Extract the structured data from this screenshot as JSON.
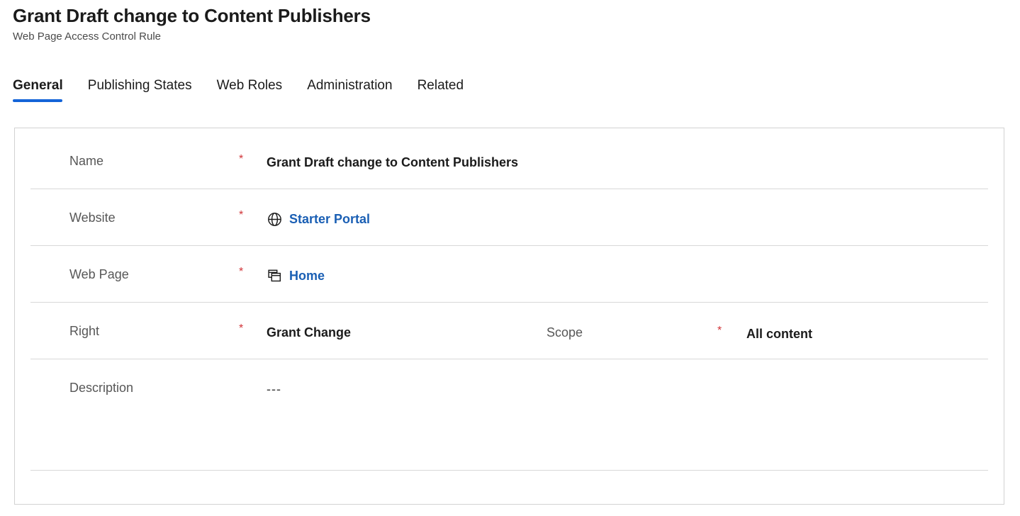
{
  "header": {
    "title": "Grant Draft change to Content Publishers",
    "subtitle": "Web Page Access Control Rule"
  },
  "tabs": [
    {
      "label": "General",
      "active": true
    },
    {
      "label": "Publishing States",
      "active": false
    },
    {
      "label": "Web Roles",
      "active": false
    },
    {
      "label": "Administration",
      "active": false
    },
    {
      "label": "Related",
      "active": false
    }
  ],
  "required_marker": "*",
  "form": {
    "name": {
      "label": "Name",
      "value": "Grant Draft change to Content Publishers"
    },
    "website": {
      "label": "Website",
      "value": "Starter Portal",
      "icon": "globe-icon"
    },
    "web_page": {
      "label": "Web Page",
      "value": "Home",
      "icon": "web-page-icon"
    },
    "right": {
      "label": "Right",
      "value": "Grant Change"
    },
    "scope": {
      "label": "Scope",
      "value": "All content"
    },
    "description": {
      "label": "Description",
      "value": "---"
    }
  },
  "colors": {
    "accent": "#1464d8",
    "link": "#1a5fb4",
    "required": "#d13438",
    "border": "#d2d2d2",
    "divider": "#d8d8d8",
    "label": "#575757",
    "text": "#1b1b1b"
  }
}
